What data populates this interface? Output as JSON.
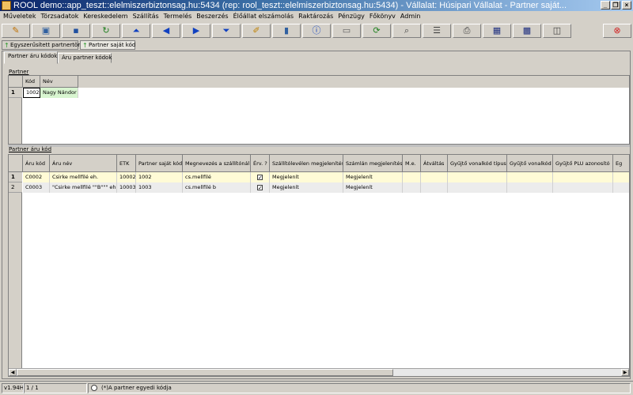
{
  "window": {
    "title": "ROOL demo::app_teszt::elelmiszerbiztonsag.hu:5434 (rep: rool_teszt::elelmiszerbiztonsag.hu:5434) - Vállalat: Húsipari Vállalat - Partner saját..."
  },
  "menu": [
    "Műveletek",
    "Törzsadatok",
    "Kereskedelem",
    "Szállítás",
    "Termelés",
    "Beszerzés",
    "Élőállat elszámolás",
    "Raktározás",
    "Pénzügy",
    "Főkönyv",
    "Admin"
  ],
  "window_tabs": [
    {
      "label": "Egyszerűsített partnertörzs"
    },
    {
      "label": "Partner saját kód"
    }
  ],
  "sub_tabs": [
    {
      "label": "Partner áru kódok",
      "active": true
    },
    {
      "label": "Áru partner kódok",
      "active": false
    }
  ],
  "partner_grid": {
    "label": "Partner",
    "columns": [
      "Kód",
      "Név"
    ],
    "rows": [
      {
        "num": "1",
        "kod": "1002",
        "nev": "Nagy Nándor"
      }
    ]
  },
  "items_grid": {
    "label": "Partner áru kód",
    "columns": [
      "Áru kód",
      "Áru név",
      "ETK",
      "Partner saját kód",
      "Megnevezés a szállítónál",
      "Érv. ?",
      "Szállítólevélen megjelenítés",
      "Számlán megjelenítés",
      "M.e.",
      "Átváltás",
      "Gyűjtő vonalkód típus",
      "Gyűjtő vonalkód",
      "Gyűjtő PLU azonosító",
      "Eg"
    ],
    "rows": [
      {
        "num": "1",
        "aru_kod": "C0002",
        "aru_nev": "Csirke mellfilé eh.",
        "etk": "10002",
        "sajat_kod": "1002",
        "megnevezes": "cs.mellfilé",
        "erv": "✓",
        "szallito": "Megjelenít",
        "szamla": "Megjelenít"
      },
      {
        "num": "2",
        "aru_kod": "C0003",
        "aru_nev": "\"Csirke mellfilé \"\"B\"\"\" eh.\"",
        "etk": "10003",
        "sajat_kod": "1003",
        "megnevezes": "cs.mellfilé b",
        "erv": "✓",
        "szallito": "Megjelenít",
        "szamla": "Megjelenít"
      }
    ]
  },
  "status": {
    "version": "v1.94H",
    "record": "1 / 1",
    "filter_label": "(*)A partner egyedi kódja"
  }
}
